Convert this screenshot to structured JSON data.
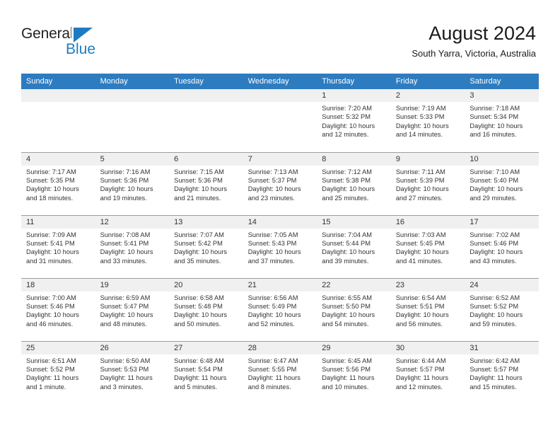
{
  "brand": {
    "name_part1": "General",
    "name_part2": "Blue",
    "accent_color": "#1f7bc1"
  },
  "header": {
    "title": "August 2024",
    "subtitle": "South Yarra, Victoria, Australia"
  },
  "calendar": {
    "header_bg": "#2e7cc0",
    "daynum_bg": "#f0f0f0",
    "weekdays": [
      "Sunday",
      "Monday",
      "Tuesday",
      "Wednesday",
      "Thursday",
      "Friday",
      "Saturday"
    ],
    "weeks": [
      [
        {
          "day": "",
          "blank": true,
          "sunrise": "",
          "sunset": "",
          "daylight_line1": "",
          "daylight_line2": ""
        },
        {
          "day": "",
          "blank": true,
          "sunrise": "",
          "sunset": "",
          "daylight_line1": "",
          "daylight_line2": ""
        },
        {
          "day": "",
          "blank": true,
          "sunrise": "",
          "sunset": "",
          "daylight_line1": "",
          "daylight_line2": ""
        },
        {
          "day": "",
          "blank": true,
          "sunrise": "",
          "sunset": "",
          "daylight_line1": "",
          "daylight_line2": ""
        },
        {
          "day": "1",
          "blank": false,
          "sunrise": "Sunrise: 7:20 AM",
          "sunset": "Sunset: 5:32 PM",
          "daylight_line1": "Daylight: 10 hours",
          "daylight_line2": "and 12 minutes."
        },
        {
          "day": "2",
          "blank": false,
          "sunrise": "Sunrise: 7:19 AM",
          "sunset": "Sunset: 5:33 PM",
          "daylight_line1": "Daylight: 10 hours",
          "daylight_line2": "and 14 minutes."
        },
        {
          "day": "3",
          "blank": false,
          "sunrise": "Sunrise: 7:18 AM",
          "sunset": "Sunset: 5:34 PM",
          "daylight_line1": "Daylight: 10 hours",
          "daylight_line2": "and 16 minutes."
        }
      ],
      [
        {
          "day": "4",
          "blank": false,
          "sunrise": "Sunrise: 7:17 AM",
          "sunset": "Sunset: 5:35 PM",
          "daylight_line1": "Daylight: 10 hours",
          "daylight_line2": "and 18 minutes."
        },
        {
          "day": "5",
          "blank": false,
          "sunrise": "Sunrise: 7:16 AM",
          "sunset": "Sunset: 5:36 PM",
          "daylight_line1": "Daylight: 10 hours",
          "daylight_line2": "and 19 minutes."
        },
        {
          "day": "6",
          "blank": false,
          "sunrise": "Sunrise: 7:15 AM",
          "sunset": "Sunset: 5:36 PM",
          "daylight_line1": "Daylight: 10 hours",
          "daylight_line2": "and 21 minutes."
        },
        {
          "day": "7",
          "blank": false,
          "sunrise": "Sunrise: 7:13 AM",
          "sunset": "Sunset: 5:37 PM",
          "daylight_line1": "Daylight: 10 hours",
          "daylight_line2": "and 23 minutes."
        },
        {
          "day": "8",
          "blank": false,
          "sunrise": "Sunrise: 7:12 AM",
          "sunset": "Sunset: 5:38 PM",
          "daylight_line1": "Daylight: 10 hours",
          "daylight_line2": "and 25 minutes."
        },
        {
          "day": "9",
          "blank": false,
          "sunrise": "Sunrise: 7:11 AM",
          "sunset": "Sunset: 5:39 PM",
          "daylight_line1": "Daylight: 10 hours",
          "daylight_line2": "and 27 minutes."
        },
        {
          "day": "10",
          "blank": false,
          "sunrise": "Sunrise: 7:10 AM",
          "sunset": "Sunset: 5:40 PM",
          "daylight_line1": "Daylight: 10 hours",
          "daylight_line2": "and 29 minutes."
        }
      ],
      [
        {
          "day": "11",
          "blank": false,
          "sunrise": "Sunrise: 7:09 AM",
          "sunset": "Sunset: 5:41 PM",
          "daylight_line1": "Daylight: 10 hours",
          "daylight_line2": "and 31 minutes."
        },
        {
          "day": "12",
          "blank": false,
          "sunrise": "Sunrise: 7:08 AM",
          "sunset": "Sunset: 5:41 PM",
          "daylight_line1": "Daylight: 10 hours",
          "daylight_line2": "and 33 minutes."
        },
        {
          "day": "13",
          "blank": false,
          "sunrise": "Sunrise: 7:07 AM",
          "sunset": "Sunset: 5:42 PM",
          "daylight_line1": "Daylight: 10 hours",
          "daylight_line2": "and 35 minutes."
        },
        {
          "day": "14",
          "blank": false,
          "sunrise": "Sunrise: 7:05 AM",
          "sunset": "Sunset: 5:43 PM",
          "daylight_line1": "Daylight: 10 hours",
          "daylight_line2": "and 37 minutes."
        },
        {
          "day": "15",
          "blank": false,
          "sunrise": "Sunrise: 7:04 AM",
          "sunset": "Sunset: 5:44 PM",
          "daylight_line1": "Daylight: 10 hours",
          "daylight_line2": "and 39 minutes."
        },
        {
          "day": "16",
          "blank": false,
          "sunrise": "Sunrise: 7:03 AM",
          "sunset": "Sunset: 5:45 PM",
          "daylight_line1": "Daylight: 10 hours",
          "daylight_line2": "and 41 minutes."
        },
        {
          "day": "17",
          "blank": false,
          "sunrise": "Sunrise: 7:02 AM",
          "sunset": "Sunset: 5:46 PM",
          "daylight_line1": "Daylight: 10 hours",
          "daylight_line2": "and 43 minutes."
        }
      ],
      [
        {
          "day": "18",
          "blank": false,
          "sunrise": "Sunrise: 7:00 AM",
          "sunset": "Sunset: 5:46 PM",
          "daylight_line1": "Daylight: 10 hours",
          "daylight_line2": "and 46 minutes."
        },
        {
          "day": "19",
          "blank": false,
          "sunrise": "Sunrise: 6:59 AM",
          "sunset": "Sunset: 5:47 PM",
          "daylight_line1": "Daylight: 10 hours",
          "daylight_line2": "and 48 minutes."
        },
        {
          "day": "20",
          "blank": false,
          "sunrise": "Sunrise: 6:58 AM",
          "sunset": "Sunset: 5:48 PM",
          "daylight_line1": "Daylight: 10 hours",
          "daylight_line2": "and 50 minutes."
        },
        {
          "day": "21",
          "blank": false,
          "sunrise": "Sunrise: 6:56 AM",
          "sunset": "Sunset: 5:49 PM",
          "daylight_line1": "Daylight: 10 hours",
          "daylight_line2": "and 52 minutes."
        },
        {
          "day": "22",
          "blank": false,
          "sunrise": "Sunrise: 6:55 AM",
          "sunset": "Sunset: 5:50 PM",
          "daylight_line1": "Daylight: 10 hours",
          "daylight_line2": "and 54 minutes."
        },
        {
          "day": "23",
          "blank": false,
          "sunrise": "Sunrise: 6:54 AM",
          "sunset": "Sunset: 5:51 PM",
          "daylight_line1": "Daylight: 10 hours",
          "daylight_line2": "and 56 minutes."
        },
        {
          "day": "24",
          "blank": false,
          "sunrise": "Sunrise: 6:52 AM",
          "sunset": "Sunset: 5:52 PM",
          "daylight_line1": "Daylight: 10 hours",
          "daylight_line2": "and 59 minutes."
        }
      ],
      [
        {
          "day": "25",
          "blank": false,
          "sunrise": "Sunrise: 6:51 AM",
          "sunset": "Sunset: 5:52 PM",
          "daylight_line1": "Daylight: 11 hours",
          "daylight_line2": "and 1 minute."
        },
        {
          "day": "26",
          "blank": false,
          "sunrise": "Sunrise: 6:50 AM",
          "sunset": "Sunset: 5:53 PM",
          "daylight_line1": "Daylight: 11 hours",
          "daylight_line2": "and 3 minutes."
        },
        {
          "day": "27",
          "blank": false,
          "sunrise": "Sunrise: 6:48 AM",
          "sunset": "Sunset: 5:54 PM",
          "daylight_line1": "Daylight: 11 hours",
          "daylight_line2": "and 5 minutes."
        },
        {
          "day": "28",
          "blank": false,
          "sunrise": "Sunrise: 6:47 AM",
          "sunset": "Sunset: 5:55 PM",
          "daylight_line1": "Daylight: 11 hours",
          "daylight_line2": "and 8 minutes."
        },
        {
          "day": "29",
          "blank": false,
          "sunrise": "Sunrise: 6:45 AM",
          "sunset": "Sunset: 5:56 PM",
          "daylight_line1": "Daylight: 11 hours",
          "daylight_line2": "and 10 minutes."
        },
        {
          "day": "30",
          "blank": false,
          "sunrise": "Sunrise: 6:44 AM",
          "sunset": "Sunset: 5:57 PM",
          "daylight_line1": "Daylight: 11 hours",
          "daylight_line2": "and 12 minutes."
        },
        {
          "day": "31",
          "blank": false,
          "sunrise": "Sunrise: 6:42 AM",
          "sunset": "Sunset: 5:57 PM",
          "daylight_line1": "Daylight: 11 hours",
          "daylight_line2": "and 15 minutes."
        }
      ]
    ]
  }
}
